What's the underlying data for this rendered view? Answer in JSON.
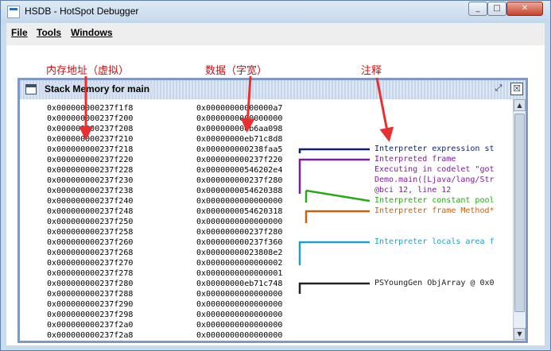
{
  "window": {
    "title": "HSDB - HotSpot Debugger",
    "min": "_",
    "max": "□",
    "close": "✕"
  },
  "menu": [
    "File",
    "Tools",
    "Windows"
  ],
  "labels": {
    "address": "内存地址（虚拟）",
    "data": "数据（字宽）",
    "annotation": "注释"
  },
  "frame": {
    "title": "Stack Memory for main",
    "restore": "⤢",
    "close": "☒"
  },
  "rows": [
    [
      "0x000000000237f1f8",
      "0x00000000000000a7"
    ],
    [
      "0x000000000237f200",
      "0x0000000000000000"
    ],
    [
      "0x000000000237f208",
      "0x00000000eb6aa098"
    ],
    [
      "0x000000000237f210",
      "0x00000000eb71c8d8"
    ],
    [
      "0x000000000237f218",
      "0x000000000238faa5"
    ],
    [
      "0x000000000237f220",
      "0x000000000237f220"
    ],
    [
      "0x000000000237f228",
      "0x00000000546202e4"
    ],
    [
      "0x000000000237f230",
      "0x000000000237f280"
    ],
    [
      "0x000000000237f238",
      "0x0000000054620388"
    ],
    [
      "0x000000000237f240",
      "0x0000000000000000"
    ],
    [
      "0x000000000237f248",
      "0x0000000054620318"
    ],
    [
      "0x000000000237f250",
      "0x0000000000000000"
    ],
    [
      "0x000000000237f258",
      "0x000000000237f280"
    ],
    [
      "0x000000000237f260",
      "0x000000000237f360"
    ],
    [
      "0x000000000237f268",
      "0x00000000023808e2"
    ],
    [
      "0x000000000237f270",
      "0x0000000000000002"
    ],
    [
      "0x000000000237f278",
      "0x0000000000000001"
    ],
    [
      "0x000000000237f280",
      "0x00000000eb71c748"
    ],
    [
      "0x000000000237f288",
      "0x0000000000000000"
    ],
    [
      "0x000000000237f290",
      "0x0000000000000000"
    ],
    [
      "0x000000000237f298",
      "0x0000000000000000"
    ],
    [
      "0x000000000237f2a0",
      "0x0000000000000000"
    ],
    [
      "0x000000000237f2a8",
      "0x0000000000000000"
    ]
  ],
  "annotations": [
    {
      "text": "Interpreter expression st",
      "color": "#0b1f7a"
    },
    {
      "text": "Interpreted frame",
      "color": "#7a1f9c"
    },
    {
      "text": "Executing in codelet \"got",
      "color": "#7a1f9c"
    },
    {
      "text": "Demo.main([Ljava/lang/Str",
      "color": "#7a1f9c"
    },
    {
      "text": "@bci 12, line 12",
      "color": "#7a1f9c"
    },
    {
      "text": "Interpreter constant pool",
      "color": "#2aa81a"
    },
    {
      "text": "Interpreter frame Method*",
      "color": "#c46210"
    },
    {
      "text": "Interpreter locals area f",
      "color": "#1ea0c8"
    },
    {
      "text": "PSYoungGen ObjArray @ 0x0",
      "color": "#222222"
    }
  ],
  "colors": {
    "arrow": "#e83030",
    "navy": "#0b1f7a",
    "purple": "#7a1f9c",
    "green": "#2aa81a",
    "orange": "#c46210",
    "cyan": "#1ea0c8",
    "black": "#222222"
  }
}
